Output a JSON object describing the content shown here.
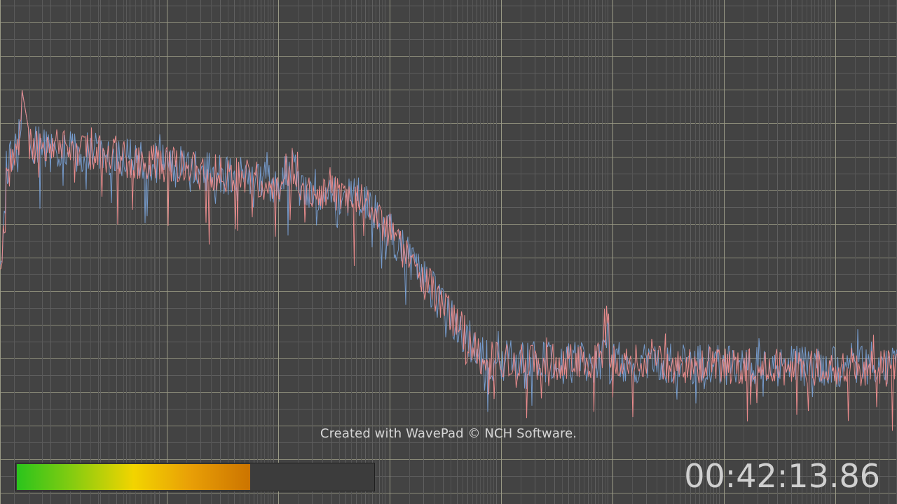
{
  "watermark": "Created with WavePad © NCH Software.",
  "timecode": "00:42:13.86",
  "level_meter": {
    "fraction": 0.655
  },
  "colors": {
    "background": "#434343",
    "grid_minor": "#626262",
    "grid_major": "#a2a28a",
    "left_channel": "#e98b8c",
    "right_channel": "#7aa3d9",
    "meter_green": "#2ac41c",
    "meter_yellow": "#f2d400",
    "meter_orange": "#cc7400"
  }
}
